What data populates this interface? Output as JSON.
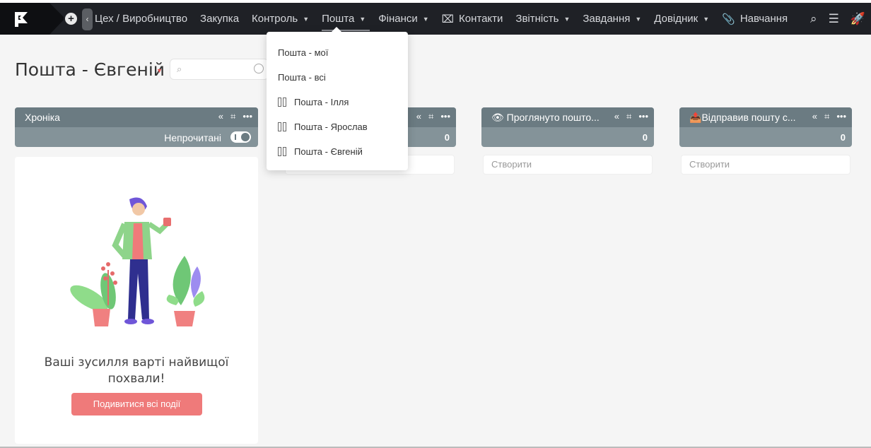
{
  "nav": {
    "items": [
      {
        "label": "Цех / Виробництво",
        "caret": false
      },
      {
        "label": "Закупка",
        "caret": false
      },
      {
        "label": "Контроль",
        "caret": true
      },
      {
        "label": "Пошта",
        "caret": true,
        "active": true
      },
      {
        "label": "Фінанси",
        "caret": true
      },
      {
        "label": "Контакти",
        "caret": false,
        "icon": "contacts-icon"
      },
      {
        "label": "Звітність",
        "caret": true
      },
      {
        "label": "Завдання",
        "caret": true
      },
      {
        "label": "Довідник",
        "caret": true
      },
      {
        "label": "Навчання",
        "caret": false,
        "icon": "paperclip-icon"
      }
    ]
  },
  "dropdown": {
    "items": [
      {
        "label": "Пошта - мої",
        "icon": false
      },
      {
        "label": "Пошта - всі",
        "icon": false
      },
      {
        "label": "Пошта - Ілля",
        "icon": true
      },
      {
        "label": "Пошта - Ярослав",
        "icon": true
      },
      {
        "label": "Пошта - Євгеній",
        "icon": true
      }
    ]
  },
  "page": {
    "title": "Пошта - Євгеній",
    "search_placeholder": ""
  },
  "columns": [
    {
      "title": "Хроніка",
      "unread_label": "Непрочитані"
    },
    {
      "title": "",
      "count": "0"
    },
    {
      "title": "Проглянуто пошто...",
      "count": "0",
      "create": "Створити",
      "emoji": "👁"
    },
    {
      "title": "Відправив пошту с...",
      "count": "0",
      "create": "Створити",
      "emoji": "📤"
    }
  ],
  "empty_state": {
    "message": "Ваші зусилля варті найвищої похвали!",
    "button": "Подивитися всі події"
  },
  "colors": {
    "topbar": "#1f2126",
    "column_header": "#6b7b82",
    "accent_button": "#ef7a7a"
  }
}
